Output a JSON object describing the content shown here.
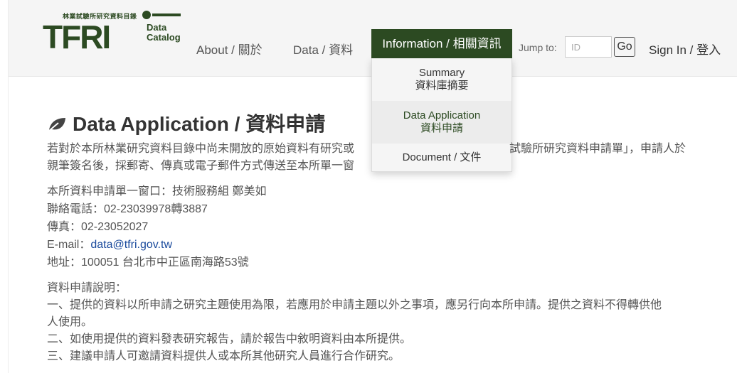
{
  "header": {
    "logo": {
      "org_name": "林業試驗所研究資料目錄",
      "mark": "TFRI",
      "sub1": "Data",
      "sub2": "Catalog"
    },
    "nav": {
      "about": "About / 關於",
      "data": "Data / 資料",
      "information": "Information / 相關資訊"
    },
    "jump": {
      "label": "Jump to:",
      "placeholder": "ID",
      "go": "Go"
    },
    "sign_in": "Sign In / 登入"
  },
  "dropdown": {
    "items": [
      {
        "line1": "Summary",
        "line2": "資料庫摘要"
      },
      {
        "line1": "Data Application",
        "line2": "資料申請"
      },
      {
        "line1": "Document / 文件",
        "line2": ""
      }
    ]
  },
  "main": {
    "title": "Data Application / 資料申請",
    "intro_line1_left": "若對於本所林業研究資料目錄中尚未開放的原始資料有研究或",
    "intro_line1_right": "試驗所研究資料申請單」，申請人於",
    "intro_line2": "親筆簽名後，採郵寄、傳真或電子郵件方式傳送至本所單一窗",
    "contact": {
      "window": "本所資料申請單一窗口：技術服務組 鄭美如",
      "phone": "聯絡電話：02-23039978轉3887",
      "fax": "傳真：02-23052027",
      "email_label": "E-mail：",
      "email": "data@tfri.gov.tw",
      "address": "地址：100051 台北市中正區南海路53號"
    },
    "notes": {
      "heading": "資料申請說明：",
      "item1a": "一、提供的資料以所申請之研究主題使用為限，若應用於申請主題以外之事項，應另行向本所申請。提供之資料不得轉供他",
      "item1b": "人使用。",
      "item2": "二、如使用提供的資料發表研究報告，請於報告中敘明資料由本所提供。",
      "item3": "三、建議申請人可邀請資料提供人或本所其他研究人員進行合作研究。"
    }
  },
  "colors": {
    "brand": "#2c4a22",
    "link": "#1a4a9c",
    "navbar_bg": "#f5f5f5"
  }
}
